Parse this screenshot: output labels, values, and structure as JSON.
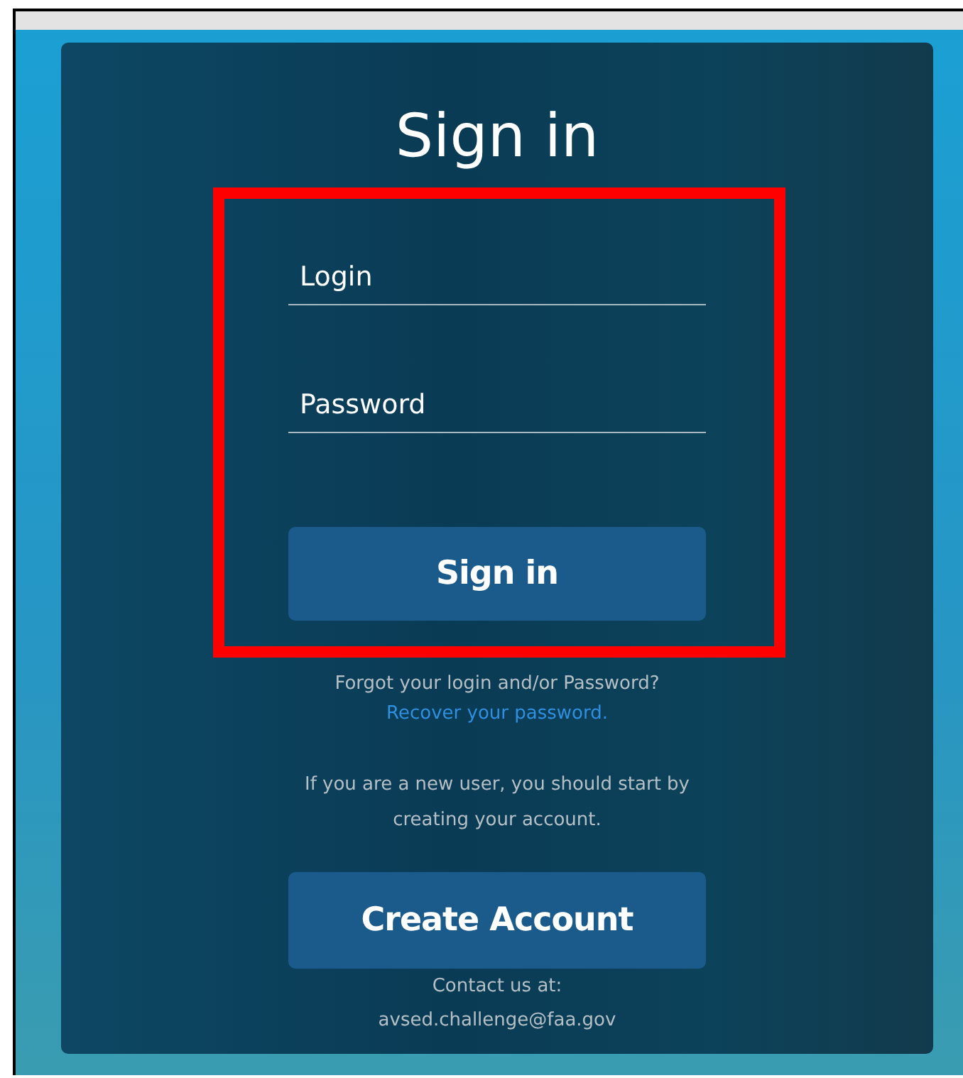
{
  "title": "Sign in",
  "fields": [
    {
      "placeholder": "Login"
    },
    {
      "placeholder": "Password"
    }
  ],
  "sign_in_button": "Sign in",
  "highlight": true,
  "forgot": {
    "text": "Forgot your login and/or Password?",
    "link": "Recover your password."
  },
  "new_user_note": "If you are a new user, you should start by creating your account.",
  "create_account_button": "Create Account",
  "contact": {
    "label": "Contact us at:",
    "email": "avsed.challenge@faa.gov"
  }
}
